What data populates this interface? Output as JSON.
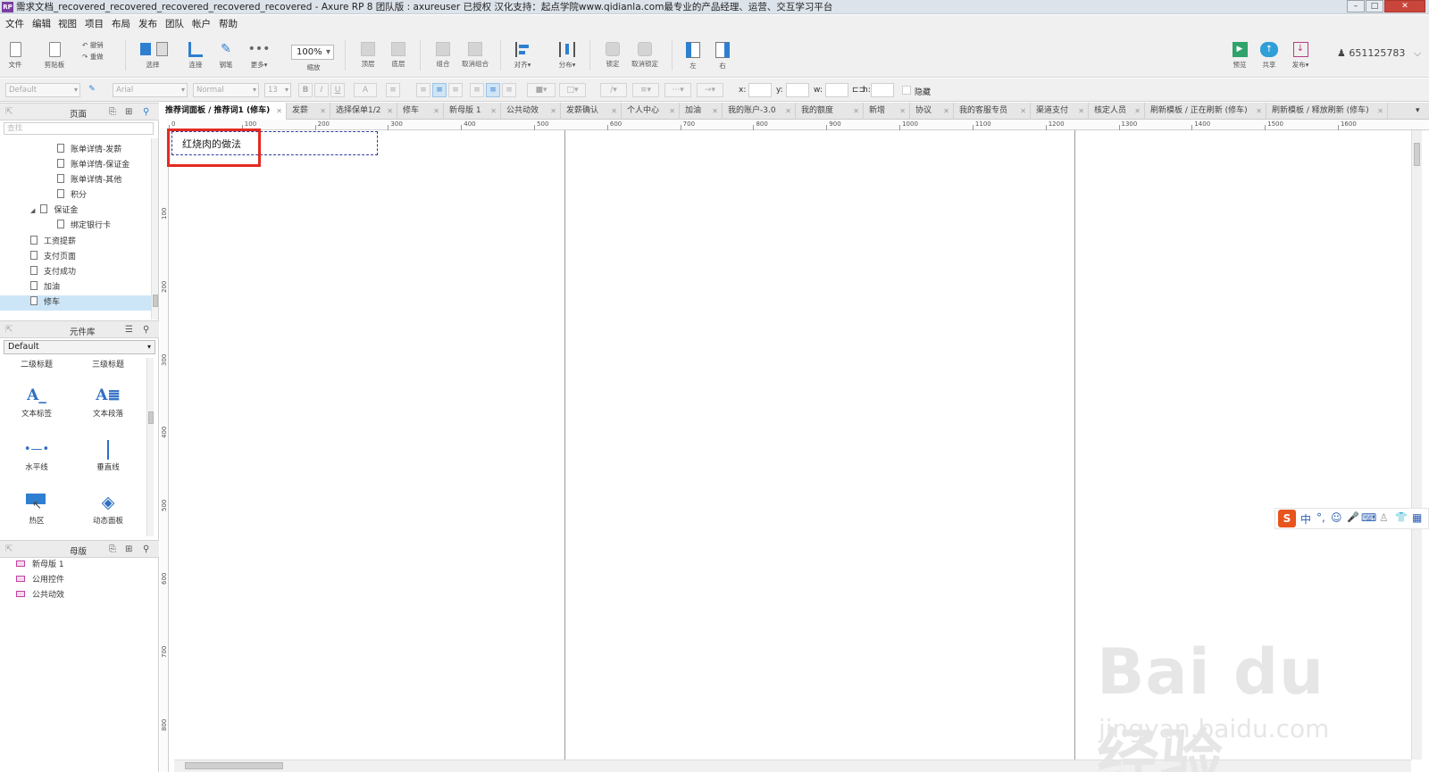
{
  "titlebar": {
    "app_icon": "RP",
    "title": "需求文档_recovered_recovered_recovered_recovered_recovered - Axure RP 8 团队版 : axureuser 已授权 汉化支持：起点学院www.qidianla.com最专业的产品经理、运营、交互学习平台",
    "min": "–",
    "max": "□",
    "close": "✕"
  },
  "menu": [
    "文件",
    "编辑",
    "视图",
    "项目",
    "布局",
    "发布",
    "团队",
    "帐户",
    "帮助"
  ],
  "toolbar": {
    "file": "文件",
    "clipboard": "剪贴板",
    "undo": "撤销",
    "redo": "重做",
    "select": "选择",
    "connect": "连接",
    "pen": "钢笔",
    "more": "更多▾",
    "zoom_value": "100%",
    "zoom_label": "缩放",
    "top": "顶层",
    "bottom": "底层",
    "group": "组合",
    "ungroup": "取消组合",
    "align": "对齐▾",
    "distribute": "分布▾",
    "lock": "锁定",
    "unlock": "取消锁定",
    "left": "左",
    "right": "右",
    "preview": "预览",
    "share": "共享",
    "publish": "发布▾",
    "user": "651125783",
    "user_icon": "person-icon"
  },
  "formatbar": {
    "style": "Default",
    "font": "Arial",
    "weight": "Normal",
    "size": "13",
    "bold": "B",
    "italic": "I",
    "underline": "U",
    "fontcolor": "A",
    "x_label": "x:",
    "y_label": "y:",
    "w_label": "w:",
    "h_label": "h:",
    "hidden_label": "隐藏"
  },
  "pages_panel": {
    "title": "页面",
    "search_placeholder": "查找",
    "items": [
      {
        "label": "账单详情-发薪"
      },
      {
        "label": "账单详情-保证金"
      },
      {
        "label": "账单详情-其他"
      },
      {
        "label": "积分"
      },
      {
        "label": "保证金",
        "expand": "◢"
      },
      {
        "label": "绑定银行卡"
      },
      {
        "label": "工资提薪"
      },
      {
        "label": "支付页面"
      },
      {
        "label": "支付成功"
      },
      {
        "label": "加油"
      },
      {
        "label": "修车"
      }
    ]
  },
  "library_panel": {
    "title": "元件库",
    "selected_library": "Default",
    "cut_labels": [
      "二级标题",
      "三级标题"
    ],
    "widgets": [
      {
        "label": "文本标签",
        "icon": "text-label-icon"
      },
      {
        "label": "文本段落",
        "icon": "text-paragraph-icon"
      },
      {
        "label": "水平线",
        "icon": "horizontal-line-icon"
      },
      {
        "label": "垂直线",
        "icon": "vertical-line-icon"
      },
      {
        "label": "热区",
        "icon": "hotspot-icon"
      },
      {
        "label": "动态面板",
        "icon": "dynamic-panel-icon"
      }
    ]
  },
  "masters_panel": {
    "title": "母版",
    "items": [
      "新母版 1",
      "公用控件",
      "公共动效"
    ]
  },
  "tabs": [
    "推荐词面板 / 推荐词1 (修车)",
    "发薪",
    "选择保单1/2",
    "修车",
    "新母版 1",
    "公共动效",
    "发薪确认",
    "个人中心",
    "加油",
    "我的账户-3.0",
    "我的额度",
    "新增",
    "协议",
    "我的客服专员",
    "渠道支付",
    "核定人员",
    "刷新模板 / 正在刷新 (修车)",
    "刷新模板 / 释放刷新 (修车)"
  ],
  "ruler": {
    "h": [
      "0",
      "100",
      "200",
      "300",
      "400",
      "500",
      "600",
      "700",
      "800",
      "900",
      "1000",
      "1100",
      "1200",
      "1300",
      "1400",
      "1500",
      "1600"
    ],
    "v": [
      "100",
      "200",
      "300",
      "400",
      "500",
      "600",
      "700",
      "800"
    ]
  },
  "canvas": {
    "label_text": "红烧肉的做法"
  },
  "ime": {
    "logo": "S",
    "chinese": "中",
    "punct": "°,",
    "smile": "☺",
    "mic": "🎤",
    "keyboard": "⌨",
    "user": "♙",
    "shirt": "👕",
    "grid": "▦"
  },
  "watermark": {
    "main": "Bai du 经验",
    "url": "jingyan.baidu.com"
  },
  "colors": {
    "highlight": "#e32a22",
    "selection": "#cde6f7",
    "accent": "#2f7fd0",
    "widget_box_border": "#2e3a9b"
  }
}
